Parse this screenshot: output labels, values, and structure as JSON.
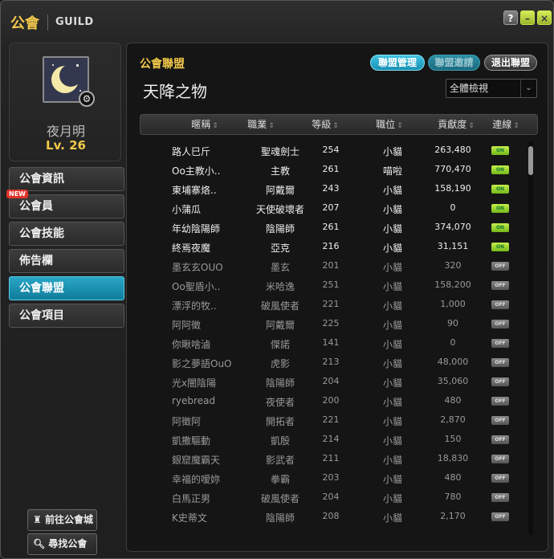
{
  "title": {
    "cn": "公會",
    "en": "GUILD"
  },
  "window_buttons": {
    "help": "?",
    "minimize": "–",
    "close": "×"
  },
  "profile": {
    "name": "夜月明",
    "level": "Lv. 26",
    "gear_icon": "gear-icon"
  },
  "nav": [
    {
      "label": "公會資訊",
      "active": false
    },
    {
      "label": "公會員",
      "active": false,
      "badge": "NEW"
    },
    {
      "label": "公會技能",
      "active": false
    },
    {
      "label": "佈告欄",
      "active": false
    },
    {
      "label": "公會聯盟",
      "active": true
    },
    {
      "label": "公會項目",
      "active": false
    }
  ],
  "bottom_buttons": [
    {
      "label": "前往公會城",
      "icon": "castle-icon"
    },
    {
      "label": "尋找公會",
      "icon": "search-icon"
    }
  ],
  "main": {
    "section_title": "公會聯盟",
    "buttons": {
      "manage": "聯盟管理",
      "invite": "聯盟邀請",
      "leave": "退出聯盟"
    },
    "alliance_name": "天降之物",
    "view_select": "全體檢視",
    "columns": [
      "暱稱",
      "職業",
      "等級",
      "職位",
      "貢獻度",
      "連線"
    ],
    "rows": [
      {
        "name": "路人巳斤",
        "job": "聖魂劍士",
        "level": "254",
        "position": "小貓",
        "contribution": "263,480",
        "online": "ON"
      },
      {
        "name": "Oo主教小..",
        "job": "主教",
        "level": "261",
        "position": "喵啦",
        "contribution": "770,470",
        "online": "ON"
      },
      {
        "name": "東埔寨烙..",
        "job": "阿戴爾",
        "level": "243",
        "position": "小貓",
        "contribution": "158,190",
        "online": "ON"
      },
      {
        "name": "小蒲瓜",
        "job": "天使破壞者",
        "level": "207",
        "position": "小貓",
        "contribution": "0",
        "online": "ON"
      },
      {
        "name": "年幼陰陽師",
        "job": "陰陽師",
        "level": "261",
        "position": "小貓",
        "contribution": "374,070",
        "online": "ON"
      },
      {
        "name": "終焉夜魔",
        "job": "亞克",
        "level": "216",
        "position": "小貓",
        "contribution": "31,151",
        "online": "ON"
      },
      {
        "name": "墨玄玄OUO",
        "job": "墨玄",
        "level": "201",
        "position": "小貓",
        "contribution": "320",
        "online": "OFF"
      },
      {
        "name": "Oo聖盾小..",
        "job": "米哈逸",
        "level": "251",
        "position": "小貓",
        "contribution": "158,200",
        "online": "OFF"
      },
      {
        "name": "漂浮的牧..",
        "job": "破風使者",
        "level": "221",
        "position": "小貓",
        "contribution": "1,000",
        "online": "OFF"
      },
      {
        "name": "阿阿徵",
        "job": "阿戴爾",
        "level": "225",
        "position": "小貓",
        "contribution": "90",
        "online": "OFF"
      },
      {
        "name": "你瞅啥滷",
        "job": "傑諾",
        "level": "141",
        "position": "小貓",
        "contribution": "0",
        "online": "OFF"
      },
      {
        "name": "影之夢語OuO",
        "job": "虎影",
        "level": "213",
        "position": "小貓",
        "contribution": "48,000",
        "online": "OFF"
      },
      {
        "name": "光x闇陰陽",
        "job": "陰陽師",
        "level": "204",
        "position": "小貓",
        "contribution": "35,060",
        "online": "OFF"
      },
      {
        "name": "ryebread",
        "job": "夜使者",
        "level": "200",
        "position": "小貓",
        "contribution": "480",
        "online": "OFF"
      },
      {
        "name": "阿徵阿",
        "job": "開拓者",
        "level": "221",
        "position": "小貓",
        "contribution": "2,870",
        "online": "OFF"
      },
      {
        "name": "凱撒驅動",
        "job": "凱殷",
        "level": "214",
        "position": "小貓",
        "contribution": "150",
        "online": "OFF"
      },
      {
        "name": "銀窟魔霸天",
        "job": "影武者",
        "level": "211",
        "position": "小貓",
        "contribution": "18,830",
        "online": "OFF"
      },
      {
        "name": "幸福的嗳妳",
        "job": "拳霸",
        "level": "203",
        "position": "小貓",
        "contribution": "480",
        "online": "OFF"
      },
      {
        "name": "白馬正男",
        "job": "破風使者",
        "level": "204",
        "position": "小貓",
        "contribution": "780",
        "online": "OFF"
      },
      {
        "name": "K史蒂文",
        "job": "陰陽師",
        "level": "208",
        "position": "小貓",
        "contribution": "2,170",
        "online": "OFF"
      }
    ]
  },
  "colors": {
    "accent": "#f2c84b",
    "active_nav": "#1f93b5",
    "online": "#9ddc2f"
  }
}
